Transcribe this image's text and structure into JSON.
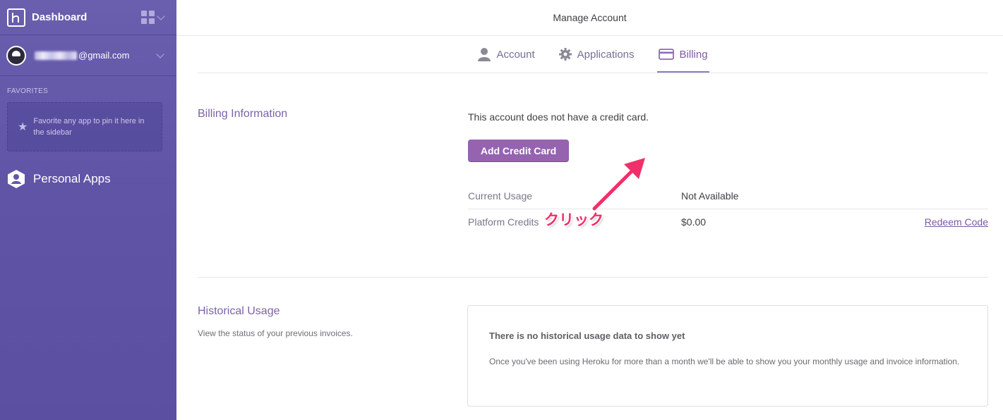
{
  "sidebar": {
    "title": "Dashboard",
    "user_email_visible": "@gmail.com",
    "favorites_label": "FAVORITES",
    "favorites_hint": "Favorite any app to pin it here in the sidebar",
    "personal_apps_label": "Personal Apps"
  },
  "header": {
    "title": "Manage Account"
  },
  "tabs": [
    {
      "label": "Account",
      "icon": "user-icon",
      "active": false
    },
    {
      "label": "Applications",
      "icon": "gear-icon",
      "active": false
    },
    {
      "label": "Billing",
      "icon": "credit-card-icon",
      "active": true
    }
  ],
  "billing": {
    "section_title": "Billing Information",
    "no_card_text": "This account does not have a credit card.",
    "add_card_button": "Add Credit Card",
    "rows": [
      {
        "label": "Current Usage",
        "value": "Not Available",
        "action": ""
      },
      {
        "label": "Platform Credits",
        "value": "$0.00",
        "action": "Redeem Code"
      }
    ]
  },
  "historical": {
    "section_title": "Historical Usage",
    "section_desc": "View the status of your previous invoices.",
    "empty_title": "There is no historical usage data to show yet",
    "empty_body": "Once you've been using Heroku for more than a month we'll be able to show you your monthly usage and invoice information."
  },
  "annotation": {
    "text": "クリック",
    "color": "#f0306a"
  },
  "colors": {
    "sidebar": "#5f54a6",
    "accent": "#9563b0",
    "link": "#7a5aa7"
  }
}
